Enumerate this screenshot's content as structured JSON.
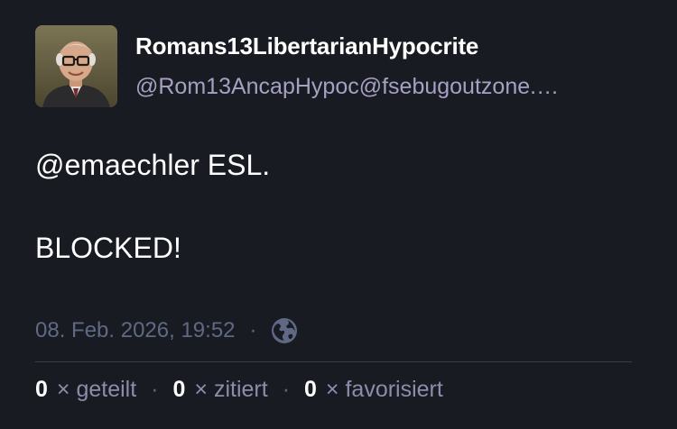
{
  "post": {
    "author": {
      "display_name": "Romans13LibertarianHypocrite",
      "handle": "@Rom13AncapHypoc@fsebugoutzone.…"
    },
    "content": {
      "mention": "@emaechler",
      "line1_rest": " ESL.",
      "line2": "BLOCKED!"
    },
    "meta": {
      "timestamp": "08. Feb. 2026, 19:52",
      "separator": "·",
      "visibility_icon": "globe-icon"
    },
    "stats": {
      "boosts_count": "0",
      "boosts_label": "× geteilt",
      "quotes_count": "0",
      "quotes_label": "× zitiert",
      "favourites_count": "0",
      "favourites_label": "× favorisiert",
      "separator": "·"
    }
  },
  "colors": {
    "background": "#191b22",
    "handle": "#a6a0c2",
    "muted": "#606984",
    "divider": "#393f4f"
  }
}
